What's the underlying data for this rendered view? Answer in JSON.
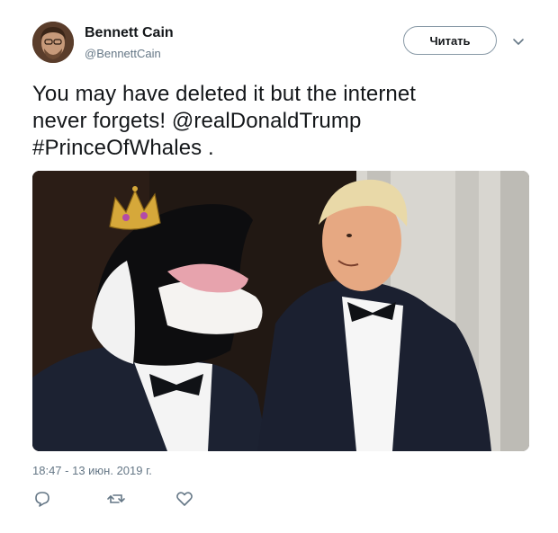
{
  "user": {
    "display_name": "Bennett Cain",
    "handle": "@BennettCain",
    "avatar_icon": "user-avatar-photo"
  },
  "header": {
    "follow_label": "Читать",
    "more_icon": "chevron-down-icon"
  },
  "tweet": {
    "text_parts": [
      "You may have deleted it but the internet",
      "never forgets! @realDonaldTrump",
      "#PrinceOfWhales ."
    ],
    "image_icon": "tweet-photo"
  },
  "meta": {
    "timestamp": "18:47 - 13 июн. 2019 г."
  },
  "actions": {
    "reply_icon": "reply-icon",
    "retweet_icon": "retweet-icon",
    "like_icon": "heart-icon"
  },
  "colors": {
    "text": "#14171a",
    "secondary": "#657786",
    "border": "#8899a6"
  }
}
